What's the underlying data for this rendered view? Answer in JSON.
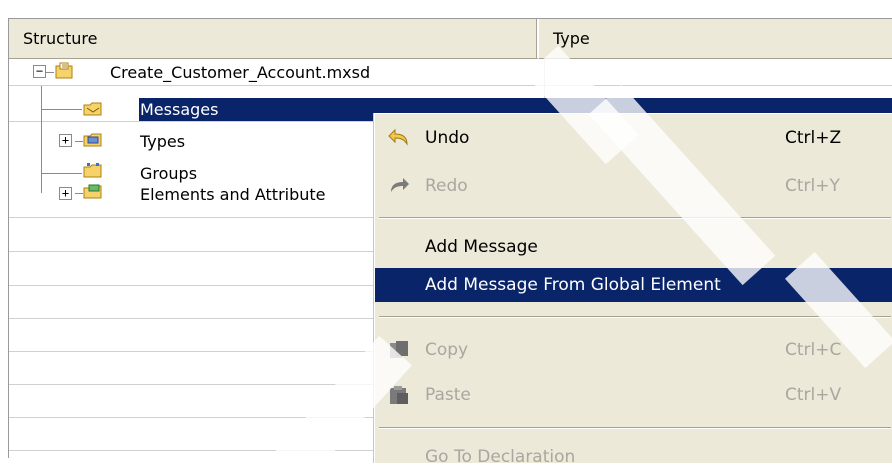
{
  "columns": {
    "structure": "Structure",
    "type": "Type"
  },
  "tree": {
    "root": {
      "label": "Create_Customer_Account.mxsd",
      "icon": "mxsd-file-icon",
      "expander": "−"
    },
    "children": [
      {
        "label": "Messages",
        "icon": "messages-folder-icon",
        "selected": true,
        "expander": ""
      },
      {
        "label": "Types",
        "icon": "types-folder-icon",
        "selected": false,
        "expander": "+"
      },
      {
        "label": "Groups",
        "icon": "groups-folder-icon",
        "selected": false,
        "expander": ""
      },
      {
        "label": "Elements and Attribute",
        "icon": "elements-folder-icon",
        "selected": false,
        "expander": "+"
      }
    ]
  },
  "context_menu": {
    "items": [
      {
        "label": "Undo",
        "shortcut": "Ctrl+Z",
        "icon": "undo-icon",
        "enabled": true
      },
      {
        "label": "Redo",
        "shortcut": "Ctrl+Y",
        "icon": "redo-icon",
        "enabled": false
      },
      {
        "label": "Add Message",
        "shortcut": "",
        "icon": "",
        "enabled": true
      },
      {
        "label": "Add Message From Global Element",
        "shortcut": "",
        "icon": "",
        "enabled": true,
        "highlighted": true
      },
      {
        "label": "Copy",
        "shortcut": "Ctrl+C",
        "icon": "copy-icon",
        "enabled": false
      },
      {
        "label": "Paste",
        "shortcut": "Ctrl+V",
        "icon": "paste-icon",
        "enabled": false
      },
      {
        "label": "Go To Declaration",
        "shortcut": "",
        "icon": "",
        "enabled": false
      }
    ]
  },
  "colors": {
    "selection": "#0a246a",
    "menu_background": "#ece9d8",
    "header_background": "#ece9d8",
    "disabled_text": "#a9a7a0"
  }
}
